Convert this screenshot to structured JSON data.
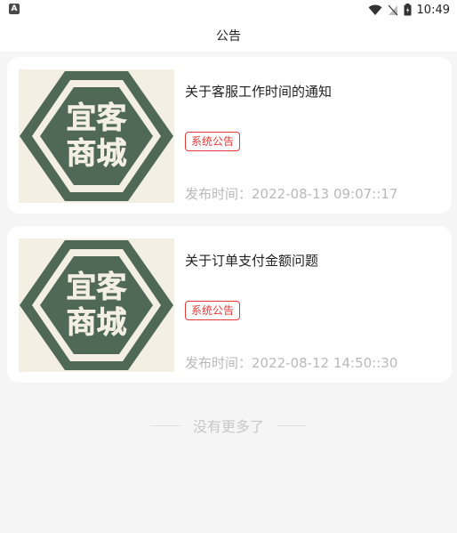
{
  "status_bar": {
    "left_icon": "A",
    "time": "10:49",
    "icons": [
      "wifi-icon",
      "signal-icon",
      "battery-icon"
    ]
  },
  "header": {
    "title": "公告"
  },
  "notices": [
    {
      "thumbnail_text_line1": "宜客",
      "thumbnail_text_line2": "商城",
      "title": "关于客服工作时间的通知",
      "tag": "系统公告",
      "time": "发布时间：2022-08-13 09:07::17"
    },
    {
      "thumbnail_text_line1": "宜客",
      "thumbnail_text_line2": "商城",
      "title": "关于订单支付金额问题",
      "tag": "系统公告",
      "time": "发布时间：2022-08-12 14:50::30"
    }
  ],
  "footer": {
    "no_more": "没有更多了"
  },
  "colors": {
    "logo_green": "#506956",
    "logo_cream": "#f3efe2",
    "tag_red": "#e53935",
    "muted_text": "#b9b9b9"
  }
}
